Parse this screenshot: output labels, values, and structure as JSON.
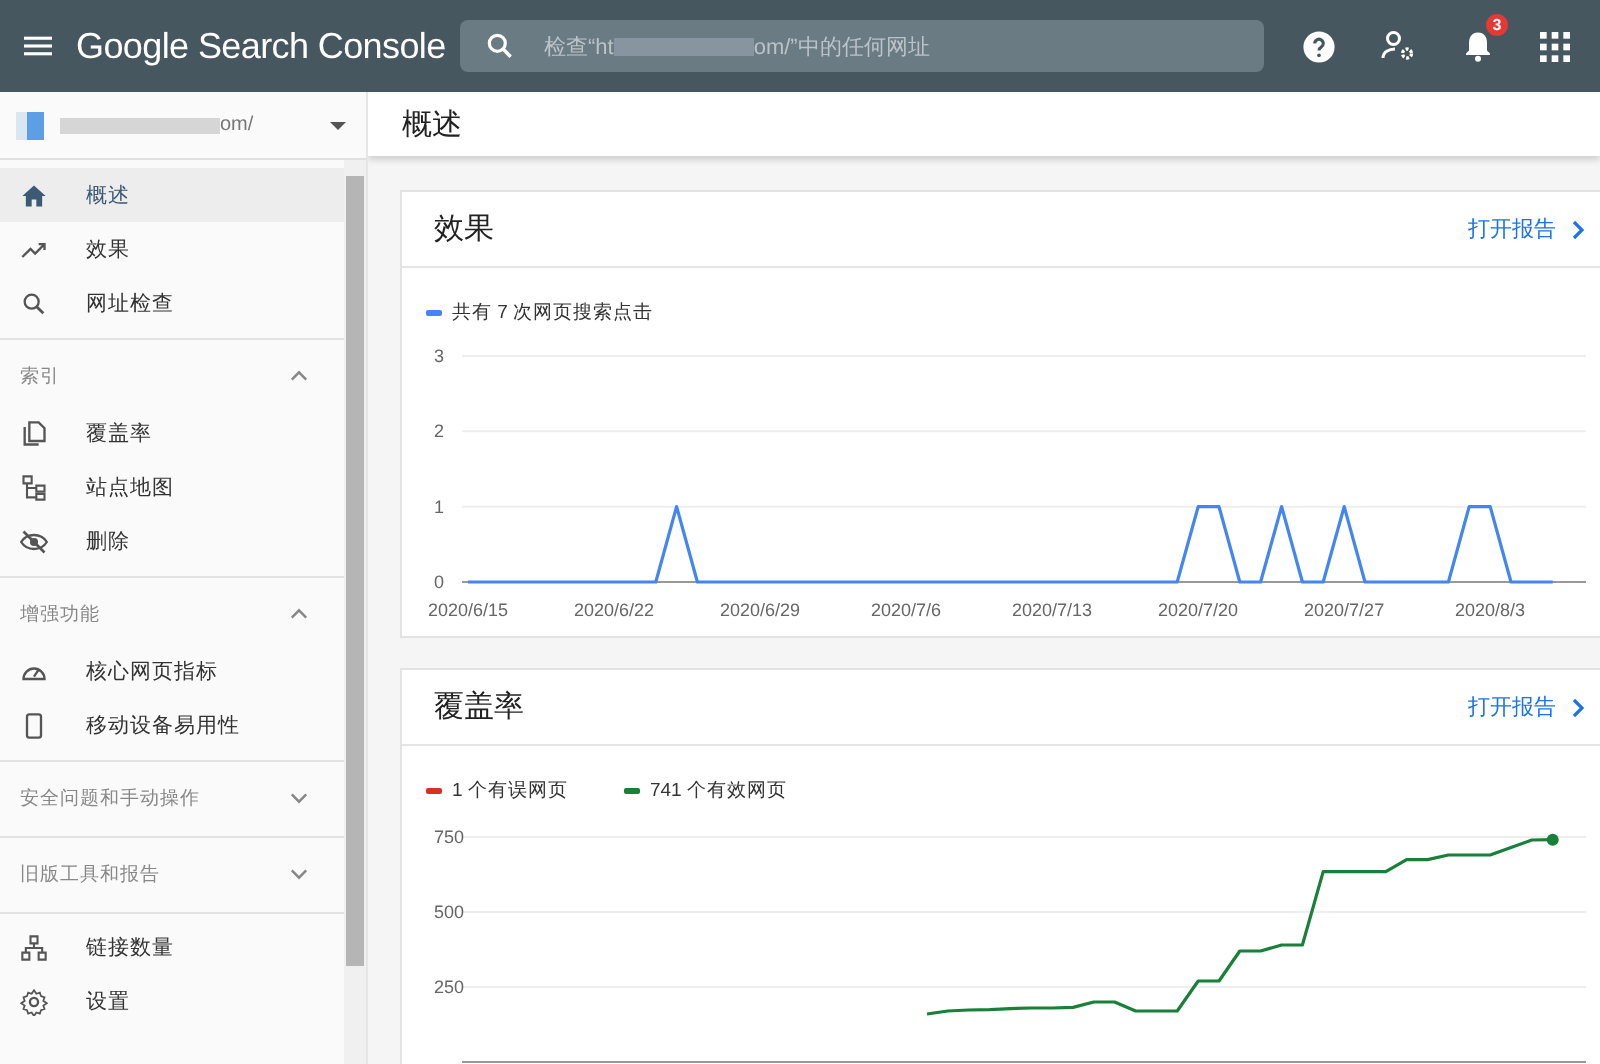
{
  "top_bar": {
    "logo": "Google Search Console",
    "search": {
      "placeholder_start": "检查“ht",
      "placeholder_end": "om/”中的任何网址"
    },
    "notification_badge": "3"
  },
  "property": {
    "name_end": "om/"
  },
  "sidebar": {
    "sections": [
      {
        "kind": "list",
        "items": [
          {
            "label": "概述",
            "selected": true
          },
          {
            "label": "效果",
            "selected": false
          },
          {
            "label": "网址检查",
            "selected": false
          }
        ]
      },
      {
        "kind": "group",
        "title": "索引",
        "expanded": true,
        "items": [
          {
            "label": "覆盖率",
            "selected": false
          },
          {
            "label": "站点地图",
            "selected": false
          },
          {
            "label": "删除",
            "selected": false
          }
        ]
      },
      {
        "kind": "group",
        "title": "增强功能",
        "expanded": true,
        "items": [
          {
            "label": "核心网页指标",
            "selected": false
          },
          {
            "label": "移动设备易用性",
            "selected": false
          }
        ]
      },
      {
        "kind": "group",
        "title": "安全问题和手动操作",
        "expanded": false
      },
      {
        "kind": "group",
        "title": "旧版工具和报告",
        "expanded": false
      },
      {
        "kind": "list",
        "items": [
          {
            "label": "链接数量",
            "selected": false
          },
          {
            "label": "设置",
            "selected": false
          }
        ]
      }
    ]
  },
  "page_title": "概述",
  "cards": [
    {
      "title": "效果",
      "link": "打开报告",
      "chart_data": {
        "type": "line",
        "categories": [
          "2020/6/15",
          null,
          null,
          null,
          null,
          null,
          null,
          "2020/6/22",
          null,
          null,
          null,
          null,
          null,
          null,
          "2020/6/29",
          null,
          null,
          null,
          null,
          null,
          null,
          "2020/7/6",
          null,
          null,
          null,
          null,
          null,
          null,
          "2020/7/13",
          null,
          null,
          null,
          null,
          null,
          null,
          "2020/7/20",
          null,
          null,
          null,
          null,
          null,
          null,
          "2020/7/27",
          null,
          null,
          null,
          null,
          null,
          null,
          "2020/8/3",
          null,
          null,
          null
        ],
        "ylim": [
          0,
          3
        ],
        "yticks": [
          0,
          1,
          2,
          3
        ],
        "series": [
          {
            "name": "共有 7 次网页搜索点击",
            "color": "#4285f4",
            "values": [
              0,
              0,
              0,
              0,
              0,
              0,
              0,
              0,
              0,
              0,
              1,
              0,
              0,
              0,
              0,
              0,
              0,
              0,
              0,
              0,
              0,
              0,
              0,
              0,
              0,
              0,
              0,
              0,
              0,
              0,
              0,
              0,
              0,
              0,
              0,
              1,
              1,
              0,
              0,
              1,
              0,
              0,
              1,
              0,
              0,
              0,
              0,
              0,
              1,
              1,
              0,
              0,
              0
            ]
          }
        ]
      }
    },
    {
      "title": "覆盖率",
      "link": "打开报告",
      "chart_data": {
        "type": "line",
        "ylim": [
          0,
          750
        ],
        "yticks": [
          250,
          500,
          750
        ],
        "series": [
          {
            "name": "1 个有误网页",
            "color": "#d93025",
            "values": [
              null,
              null,
              null,
              null,
              null,
              null,
              null,
              null,
              null,
              null,
              null,
              null,
              null,
              null,
              null,
              null,
              null,
              null,
              null,
              null,
              null,
              null,
              null,
              null,
              null,
              null,
              null,
              null,
              null,
              null,
              null,
              null,
              null,
              null,
              null,
              null,
              null,
              null,
              null,
              null,
              null,
              null,
              null,
              null,
              null,
              null,
              null,
              null,
              null,
              null,
              null,
              null,
              null
            ]
          },
          {
            "name": "741 个有效网页",
            "color": "#188038",
            "values": [
              null,
              null,
              null,
              null,
              null,
              null,
              null,
              null,
              null,
              null,
              null,
              null,
              null,
              null,
              null,
              null,
              null,
              null,
              null,
              null,
              null,
              null,
              160,
              170,
              173,
              175,
              178,
              180,
              180,
              182,
              200,
              200,
              170,
              170,
              170,
              270,
              270,
              370,
              370,
              390,
              390,
              635,
              635,
              635,
              635,
              675,
              675,
              690,
              690,
              690,
              715,
              740,
              741
            ]
          }
        ]
      }
    }
  ]
}
